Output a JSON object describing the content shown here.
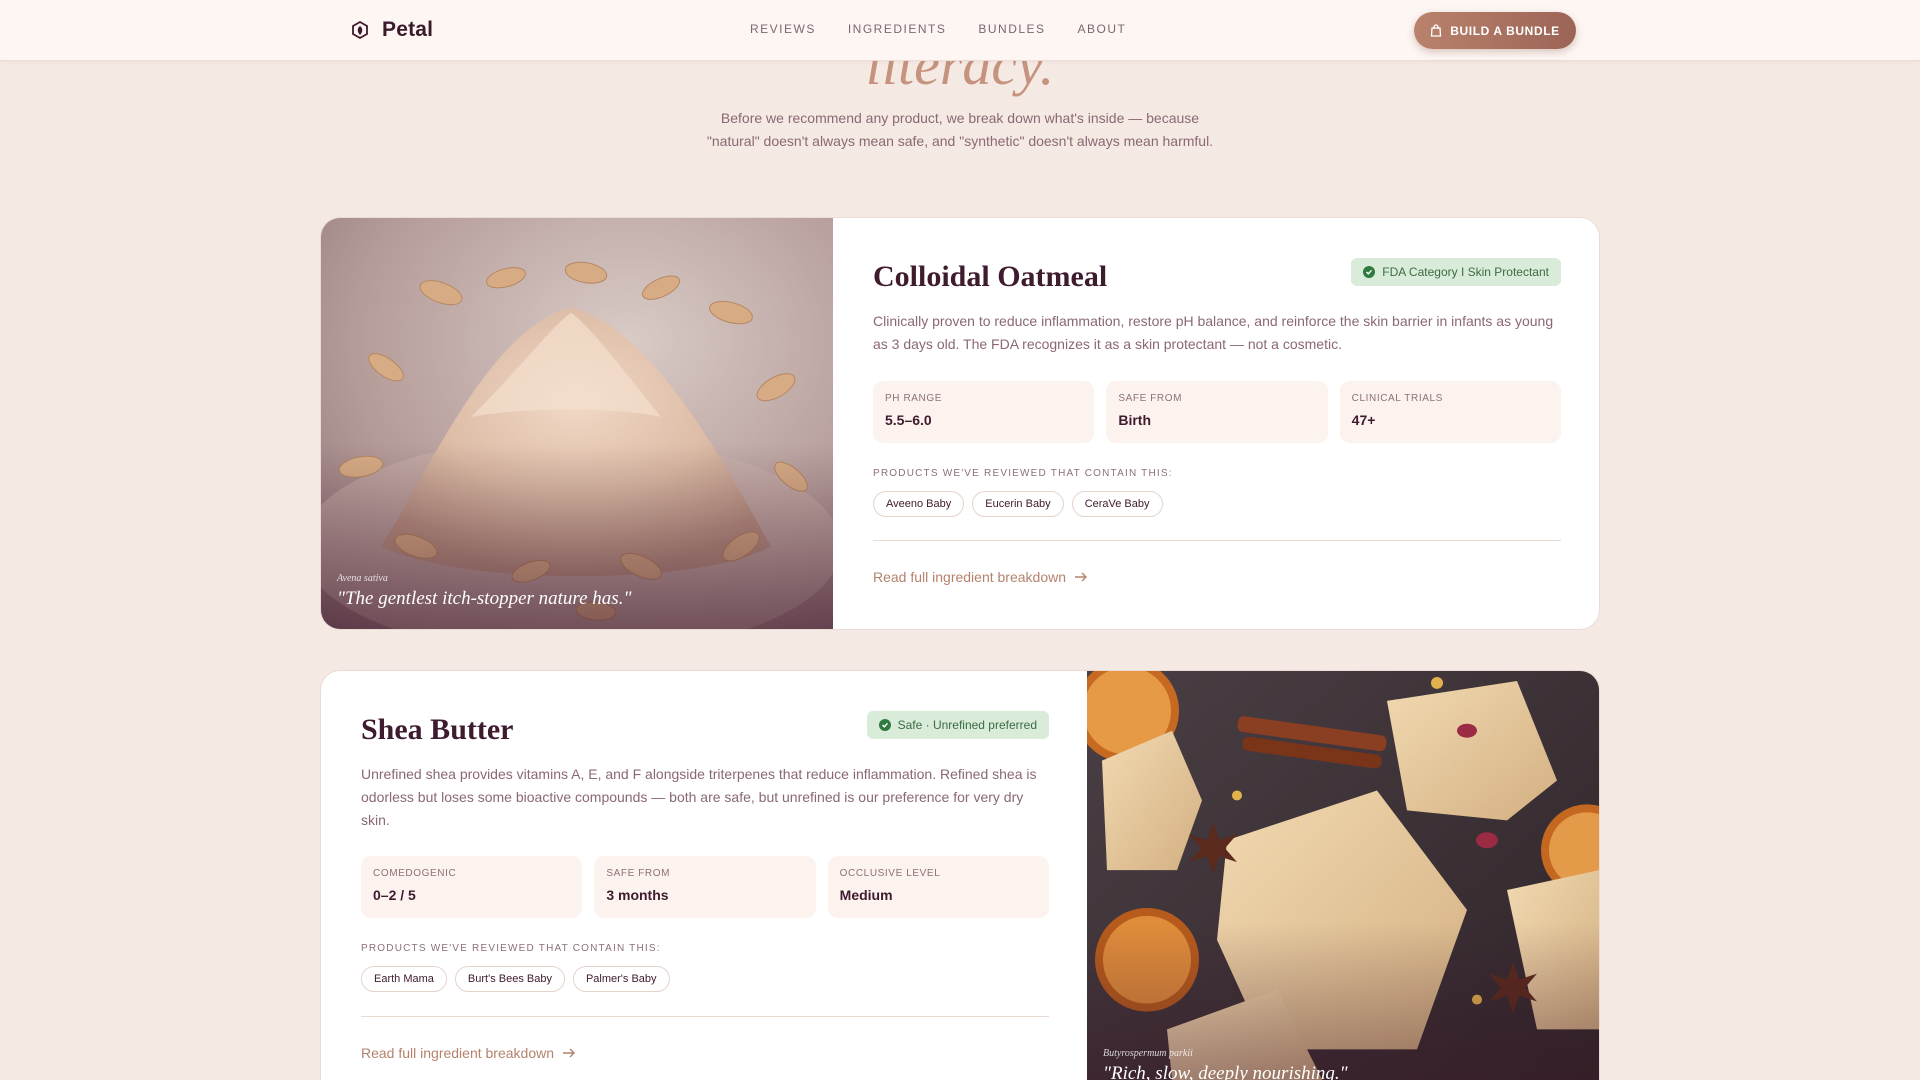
{
  "header": {
    "brand": "Petal",
    "nav": [
      "REVIEWS",
      "INGREDIENTS",
      "BUNDLES",
      "ABOUT"
    ],
    "cta_label": "BUILD A BUNDLE"
  },
  "hero": {
    "title_fragment": "literacy.",
    "subtitle_line1": "Before we recommend any product, we break down what's inside — because",
    "subtitle_line2": "\"natural\" doesn't always mean safe, and \"synthetic\" doesn't always mean harmful."
  },
  "colors": {
    "page_bg": "#f5e9e3",
    "accent": "#b4826d",
    "heading": "#3e1b2e",
    "badge_bg": "#d8ecd9",
    "badge_text": "#3d6b44"
  },
  "ingredients": [
    {
      "name": "Colloidal Oatmeal",
      "badge": "FDA Category I Skin Protectant",
      "description": "Clinically proven to reduce inflammation, restore pH balance, and reinforce the skin barrier in infants as young as 3 days old. The FDA recognizes it as a skin protectant — not a cosmetic.",
      "stats": [
        {
          "label": "PH RANGE",
          "value": "5.5–6.0"
        },
        {
          "label": "SAFE FROM",
          "value": "Birth"
        },
        {
          "label": "CLINICAL TRIALS",
          "value": "47+"
        }
      ],
      "contain_label": "PRODUCTS WE'VE REVIEWED THAT CONTAIN THIS:",
      "products": [
        "Aveeno Baby",
        "Eucerin Baby",
        "CeraVe Baby"
      ],
      "link": "Read full ingredient breakdown",
      "photo_latin": "Avena sativa",
      "photo_quote": "\"The gentlest itch-stopper nature has.\"",
      "photo_icon": "oatmeal-pile-photo"
    },
    {
      "name": "Shea Butter",
      "badge": "Safe · Unrefined preferred",
      "description": "Unrefined shea provides vitamins A, E, and F alongside triterpenes that reduce inflammation. Refined shea is odorless but loses some bioactive compounds — both are safe, but unrefined is our preference for very dry skin.",
      "stats": [
        {
          "label": "COMEDOGENIC",
          "value": "0–2 / 5"
        },
        {
          "label": "SAFE FROM",
          "value": "3 months"
        },
        {
          "label": "OCCLUSIVE LEVEL",
          "value": "Medium"
        }
      ],
      "contain_label": "PRODUCTS WE'VE REVIEWED THAT CONTAIN THIS:",
      "products": [
        "Earth Mama",
        "Burt's Bees Baby",
        "Palmer's Baby"
      ],
      "link": "Read full ingredient breakdown",
      "photo_latin": "Butyrospermum parkii",
      "photo_quote": "\"Rich, slow, deeply nourishing.\"",
      "photo_icon": "shea-butter-blocks-photo"
    }
  ]
}
